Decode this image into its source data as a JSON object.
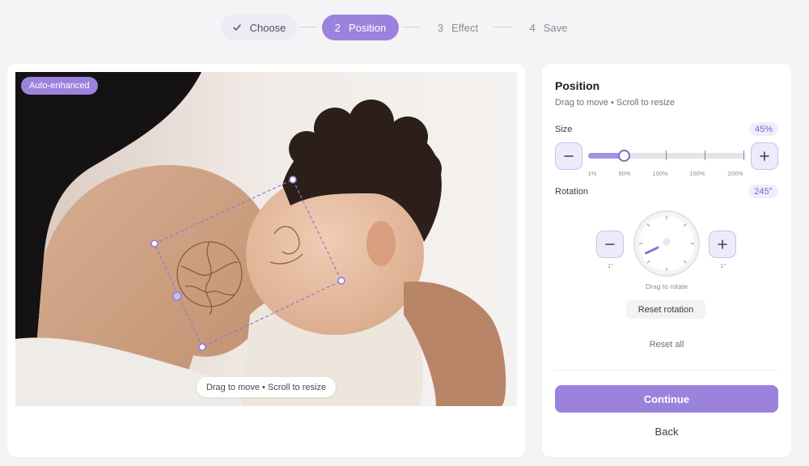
{
  "stepper": {
    "steps": [
      {
        "num": "",
        "label": "Choose",
        "state": "done"
      },
      {
        "num": "2",
        "label": "Position",
        "state": "active"
      },
      {
        "num": "3",
        "label": "Effect",
        "state": "todo"
      },
      {
        "num": "4",
        "label": "Save",
        "state": "todo"
      }
    ]
  },
  "canvas": {
    "badge": "Auto-enhanced",
    "hint": "Drag to move • Scroll to resize"
  },
  "panel": {
    "title": "Position",
    "subtitle": "Drag to move • Scroll to resize",
    "size": {
      "label": "Size",
      "value": "45%",
      "level": 0.45,
      "scale": [
        "1%",
        "50%",
        "100%",
        "150%",
        "200%"
      ]
    },
    "rotation": {
      "label": "Rotation",
      "value": "245°",
      "degrees": 245,
      "step_left": "1°",
      "step_right": "1°",
      "dial_hint": "Drag to rotate",
      "reset_label": "Reset rotation"
    },
    "reset_all": "Reset all",
    "continue_label": "Continue",
    "back_label": "Back"
  },
  "colors": {
    "accent": "#9b83dd",
    "accent_soft": "#ecebfa",
    "accent_text": "#7a62c9"
  },
  "icons": {
    "check": "check-icon",
    "minus": "minus-icon",
    "plus": "plus-icon"
  }
}
